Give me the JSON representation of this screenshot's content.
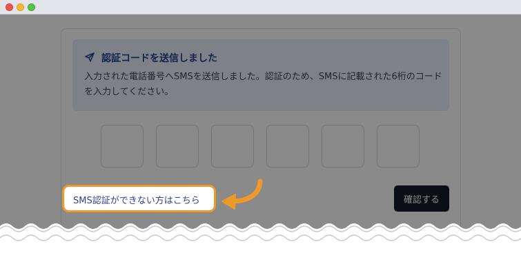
{
  "notice": {
    "title": "認証コードを送信しました",
    "body": "入力された電話番号へSMSを送信しました。認証のため、SMSに記載された6桁のコードを入力してください。",
    "icon": "send-icon"
  },
  "otp": {
    "digit_count": 6,
    "values": [
      "",
      "",
      "",
      "",
      "",
      ""
    ]
  },
  "actions": {
    "sms_link_label": "SMS認証ができない方はこちら",
    "confirm_label": "確認する"
  },
  "colors": {
    "accent": "#25408f",
    "highlight": "#ee9a2b",
    "button": "#161b26",
    "notice_bg": "#e9eff9"
  }
}
